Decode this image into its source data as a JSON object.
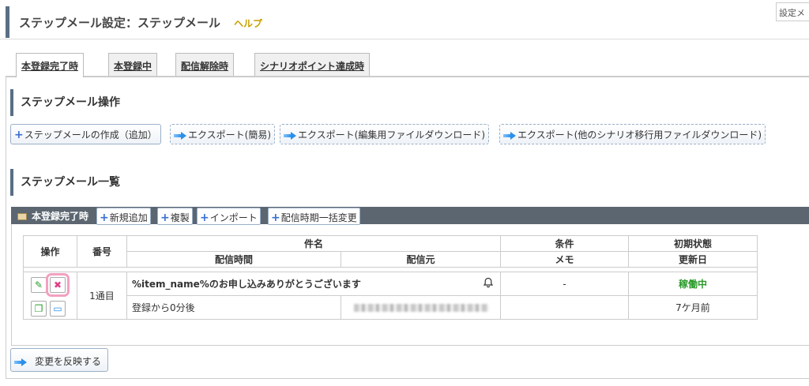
{
  "header": {
    "title": "ステップメール設定：ステップメール",
    "help": "ヘルプ",
    "settings_menu": "設定メ"
  },
  "tabs": [
    {
      "label": "本登録完了時",
      "active": true
    },
    {
      "label": "本登録中",
      "active": false
    },
    {
      "label": "配信解除時",
      "active": false
    },
    {
      "label": "シナリオポイント達成時",
      "active": false
    }
  ],
  "operations": {
    "title": "ステップメール操作",
    "create": "ステップメールの作成（追加）",
    "export_simple": "エクスポート(簡易)",
    "export_edit": "エクスポート(編集用ファイルダウンロード)",
    "export_other": "エクスポート(他のシナリオ移行用ファイルダウンロード)"
  },
  "list": {
    "title": "ステップメール一覧",
    "group_label": "本登録完了時",
    "new": "新規追加",
    "duplicate": "複製",
    "import": "インポート",
    "bulk_timing": "配信時期一括変更",
    "columns": {
      "action": "操作",
      "number": "番号",
      "subject": "件名",
      "timing": "配信時間",
      "sender": "配信元",
      "condition": "条件",
      "memo": "メモ",
      "initial_status": "初期状態",
      "updated": "更新日"
    },
    "rows": [
      {
        "number": "1通目",
        "subject": "%item_name%のお申し込みありがとうございます",
        "condition": "-",
        "status": "稼働中",
        "timing": "登録から0分後",
        "sender": "",
        "memo": "",
        "updated": "7ケ月前"
      }
    ]
  },
  "apply_button": "変更を反映する",
  "colors": {
    "accent": "#5a6e85",
    "status_running": "#2a9a2a",
    "highlight": "#f4a0c0"
  }
}
